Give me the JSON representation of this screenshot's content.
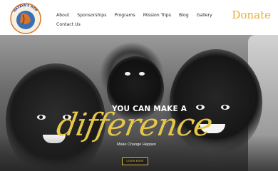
{
  "logo": {
    "text": "HAYAYA'S HOPE"
  },
  "nav": {
    "row1": [
      "About",
      "Sponsorships",
      "Programs",
      "Mission Trips",
      "Blog",
      "Gallery"
    ],
    "row2": [
      "Contact Us"
    ]
  },
  "donate_label": "Donate",
  "hero": {
    "tagline": "YOU CAN MAKE A",
    "script_word": "difference",
    "subtitle": "Make Change Happen",
    "cta_label": "LEARN MORE"
  },
  "colors": {
    "accent": "#e7c74a",
    "logo_ring": "#d8742a"
  }
}
